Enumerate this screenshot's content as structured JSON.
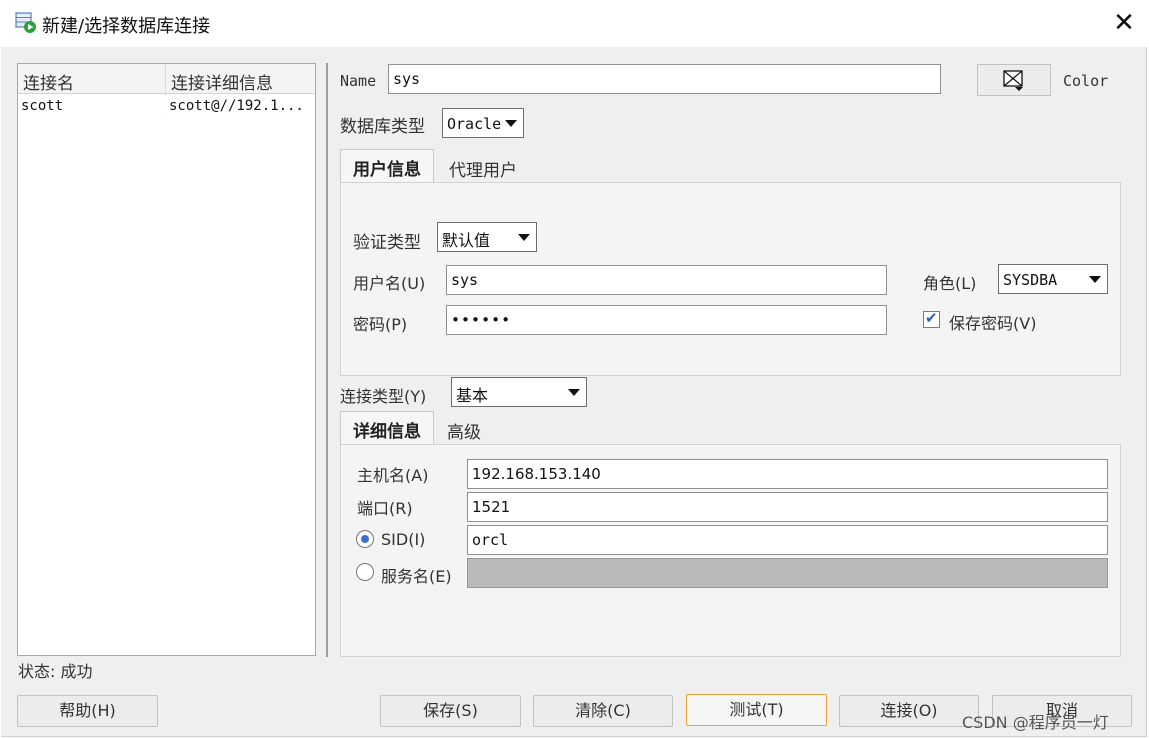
{
  "window": {
    "title": "新建/选择数据库连接",
    "close_glyph": "✕"
  },
  "connections": {
    "columns": [
      "连接名",
      "连接详细信息"
    ],
    "rows": [
      {
        "name": "scott",
        "details": "scott@//192.1..."
      }
    ]
  },
  "form": {
    "name_label": "Name",
    "name_value": "sys",
    "color_label": "Color",
    "db_type_label": "数据库类型",
    "db_type_value": "Oracle",
    "tabs_user": [
      "用户信息",
      "代理用户"
    ],
    "auth_type_label": "验证类型",
    "auth_type_value": "默认值",
    "username_label": "用户名(U)",
    "username_value": "sys",
    "password_label": "密码(P)",
    "password_value": "••••••",
    "role_label": "角色(L)",
    "role_value": "SYSDBA",
    "save_password_label": "保存密码(V)",
    "save_password_checked": true,
    "conn_type_label": "连接类型(Y)",
    "conn_type_value": "基本",
    "tabs_detail": [
      "详细信息",
      "高级"
    ],
    "host_label": "主机名(A)",
    "host_value": "192.168.153.140",
    "port_label": "端口(R)",
    "port_value": "1521",
    "sid_label": "SID(I)",
    "sid_value": "orcl",
    "sid_selected": true,
    "service_label": "服务名(E)",
    "service_value": ""
  },
  "status": {
    "text": "状态: 成功"
  },
  "buttons": {
    "help": "帮助(H)",
    "save": "保存(S)",
    "clear": "清除(C)",
    "test": "测试(T)",
    "connect": "连接(O)",
    "cancel": "取消"
  },
  "watermark": "CSDN @程序员一灯",
  "icons": {
    "app": "database-connect-icon",
    "color_picker": "color-picker-icon",
    "checkbox_mark": "✔"
  }
}
